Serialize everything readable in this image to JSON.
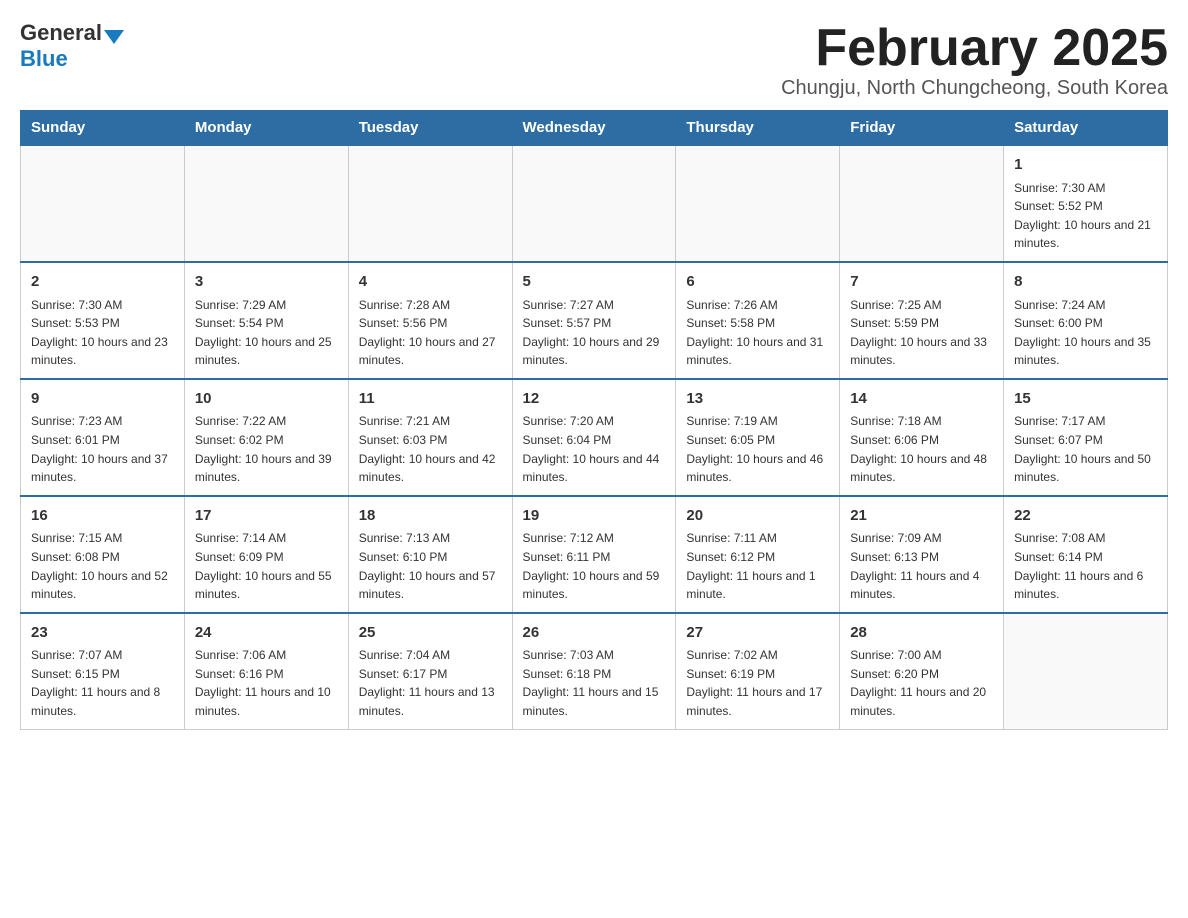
{
  "header": {
    "logo_general": "General",
    "logo_blue": "Blue",
    "month_title": "February 2025",
    "subtitle": "Chungju, North Chungcheong, South Korea"
  },
  "weekdays": [
    "Sunday",
    "Monday",
    "Tuesday",
    "Wednesday",
    "Thursday",
    "Friday",
    "Saturday"
  ],
  "weeks": [
    [
      {
        "day": "",
        "info": ""
      },
      {
        "day": "",
        "info": ""
      },
      {
        "day": "",
        "info": ""
      },
      {
        "day": "",
        "info": ""
      },
      {
        "day": "",
        "info": ""
      },
      {
        "day": "",
        "info": ""
      },
      {
        "day": "1",
        "info": "Sunrise: 7:30 AM\nSunset: 5:52 PM\nDaylight: 10 hours and 21 minutes."
      }
    ],
    [
      {
        "day": "2",
        "info": "Sunrise: 7:30 AM\nSunset: 5:53 PM\nDaylight: 10 hours and 23 minutes."
      },
      {
        "day": "3",
        "info": "Sunrise: 7:29 AM\nSunset: 5:54 PM\nDaylight: 10 hours and 25 minutes."
      },
      {
        "day": "4",
        "info": "Sunrise: 7:28 AM\nSunset: 5:56 PM\nDaylight: 10 hours and 27 minutes."
      },
      {
        "day": "5",
        "info": "Sunrise: 7:27 AM\nSunset: 5:57 PM\nDaylight: 10 hours and 29 minutes."
      },
      {
        "day": "6",
        "info": "Sunrise: 7:26 AM\nSunset: 5:58 PM\nDaylight: 10 hours and 31 minutes."
      },
      {
        "day": "7",
        "info": "Sunrise: 7:25 AM\nSunset: 5:59 PM\nDaylight: 10 hours and 33 minutes."
      },
      {
        "day": "8",
        "info": "Sunrise: 7:24 AM\nSunset: 6:00 PM\nDaylight: 10 hours and 35 minutes."
      }
    ],
    [
      {
        "day": "9",
        "info": "Sunrise: 7:23 AM\nSunset: 6:01 PM\nDaylight: 10 hours and 37 minutes."
      },
      {
        "day": "10",
        "info": "Sunrise: 7:22 AM\nSunset: 6:02 PM\nDaylight: 10 hours and 39 minutes."
      },
      {
        "day": "11",
        "info": "Sunrise: 7:21 AM\nSunset: 6:03 PM\nDaylight: 10 hours and 42 minutes."
      },
      {
        "day": "12",
        "info": "Sunrise: 7:20 AM\nSunset: 6:04 PM\nDaylight: 10 hours and 44 minutes."
      },
      {
        "day": "13",
        "info": "Sunrise: 7:19 AM\nSunset: 6:05 PM\nDaylight: 10 hours and 46 minutes."
      },
      {
        "day": "14",
        "info": "Sunrise: 7:18 AM\nSunset: 6:06 PM\nDaylight: 10 hours and 48 minutes."
      },
      {
        "day": "15",
        "info": "Sunrise: 7:17 AM\nSunset: 6:07 PM\nDaylight: 10 hours and 50 minutes."
      }
    ],
    [
      {
        "day": "16",
        "info": "Sunrise: 7:15 AM\nSunset: 6:08 PM\nDaylight: 10 hours and 52 minutes."
      },
      {
        "day": "17",
        "info": "Sunrise: 7:14 AM\nSunset: 6:09 PM\nDaylight: 10 hours and 55 minutes."
      },
      {
        "day": "18",
        "info": "Sunrise: 7:13 AM\nSunset: 6:10 PM\nDaylight: 10 hours and 57 minutes."
      },
      {
        "day": "19",
        "info": "Sunrise: 7:12 AM\nSunset: 6:11 PM\nDaylight: 10 hours and 59 minutes."
      },
      {
        "day": "20",
        "info": "Sunrise: 7:11 AM\nSunset: 6:12 PM\nDaylight: 11 hours and 1 minute."
      },
      {
        "day": "21",
        "info": "Sunrise: 7:09 AM\nSunset: 6:13 PM\nDaylight: 11 hours and 4 minutes."
      },
      {
        "day": "22",
        "info": "Sunrise: 7:08 AM\nSunset: 6:14 PM\nDaylight: 11 hours and 6 minutes."
      }
    ],
    [
      {
        "day": "23",
        "info": "Sunrise: 7:07 AM\nSunset: 6:15 PM\nDaylight: 11 hours and 8 minutes."
      },
      {
        "day": "24",
        "info": "Sunrise: 7:06 AM\nSunset: 6:16 PM\nDaylight: 11 hours and 10 minutes."
      },
      {
        "day": "25",
        "info": "Sunrise: 7:04 AM\nSunset: 6:17 PM\nDaylight: 11 hours and 13 minutes."
      },
      {
        "day": "26",
        "info": "Sunrise: 7:03 AM\nSunset: 6:18 PM\nDaylight: 11 hours and 15 minutes."
      },
      {
        "day": "27",
        "info": "Sunrise: 7:02 AM\nSunset: 6:19 PM\nDaylight: 11 hours and 17 minutes."
      },
      {
        "day": "28",
        "info": "Sunrise: 7:00 AM\nSunset: 6:20 PM\nDaylight: 11 hours and 20 minutes."
      },
      {
        "day": "",
        "info": ""
      }
    ]
  ]
}
